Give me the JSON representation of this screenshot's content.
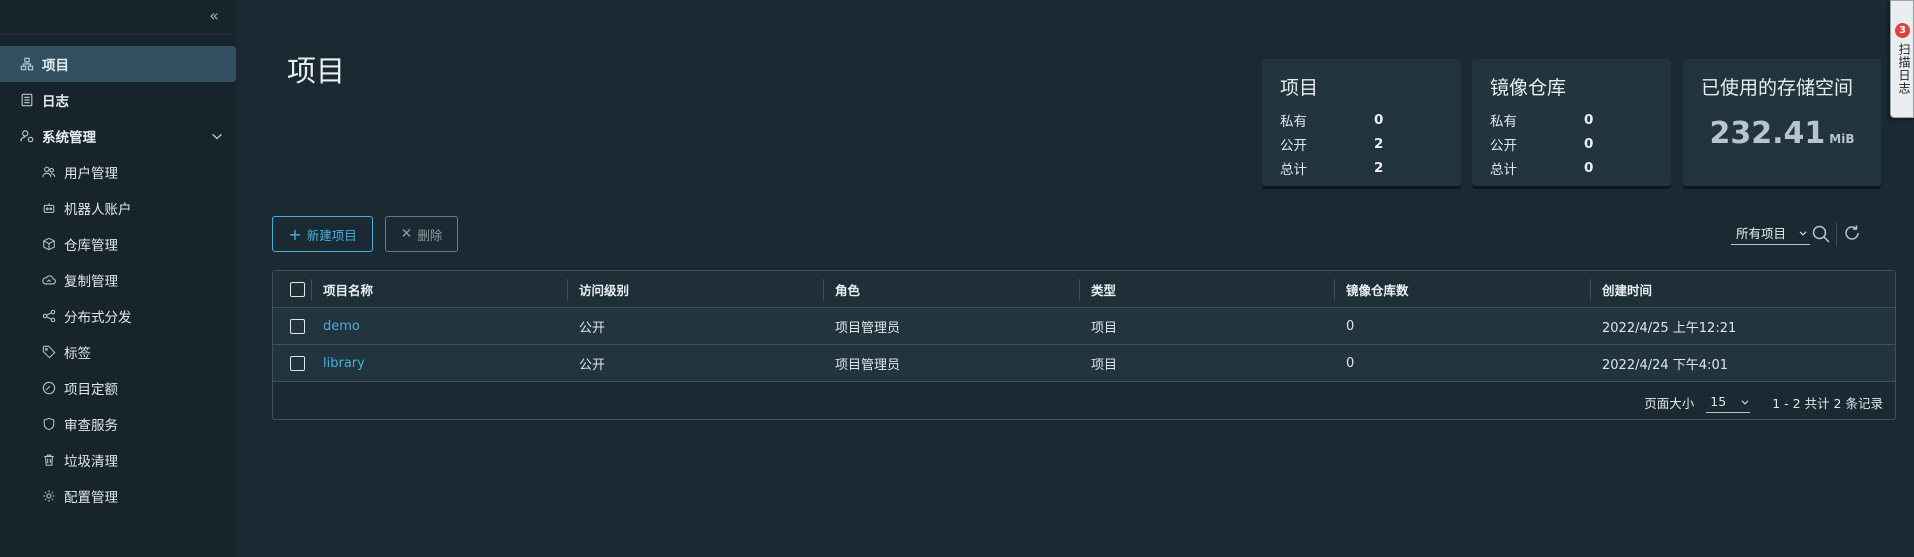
{
  "sidebar": {
    "items": [
      {
        "label": "项目",
        "icon": "projects-icon",
        "active": true
      },
      {
        "label": "日志",
        "icon": "logs-icon"
      },
      {
        "label": "系统管理",
        "icon": "admin-icon",
        "expanded": true
      },
      {
        "label": "用户管理",
        "icon": "users-icon"
      },
      {
        "label": "机器人账户",
        "icon": "robot-icon"
      },
      {
        "label": "仓库管理",
        "icon": "registry-icon"
      },
      {
        "label": "复制管理",
        "icon": "replication-icon"
      },
      {
        "label": "分布式分发",
        "icon": "distribution-icon"
      },
      {
        "label": "标签",
        "icon": "tag-icon"
      },
      {
        "label": "项目定额",
        "icon": "quota-icon"
      },
      {
        "label": "审查服务",
        "icon": "shield-icon"
      },
      {
        "label": "垃圾清理",
        "icon": "trash-icon"
      },
      {
        "label": "配置管理",
        "icon": "gear-icon"
      }
    ]
  },
  "main": {
    "title": "项目",
    "cards": {
      "projects": {
        "title": "项目",
        "rows": [
          {
            "label": "私有",
            "value": "0"
          },
          {
            "label": "公开",
            "value": "2"
          },
          {
            "label": "总计",
            "value": "2"
          }
        ]
      },
      "repos": {
        "title": "镜像仓库",
        "rows": [
          {
            "label": "私有",
            "value": "0"
          },
          {
            "label": "公开",
            "value": "0"
          },
          {
            "label": "总计",
            "value": "0"
          }
        ]
      },
      "storage": {
        "title": "已使用的存储空间",
        "value": "232.41",
        "unit": "MiB"
      }
    },
    "toolbar": {
      "new_label": "新建项目",
      "delete_label": "删除",
      "filter_value": "所有项目"
    },
    "table": {
      "headers": [
        "项目名称",
        "访问级别",
        "角色",
        "类型",
        "镜像仓库数",
        "创建时间"
      ],
      "rows": [
        [
          "demo",
          "公开",
          "项目管理员",
          "项目",
          "0",
          "2022/4/25 上午12:21"
        ],
        [
          "library",
          "公开",
          "项目管理员",
          "项目",
          "0",
          "2022/4/24 下午4:01"
        ]
      ],
      "footer": {
        "page_size_label": "页面大小",
        "page_size": "15",
        "summary": "1 - 2 共计 2 条记录"
      }
    }
  },
  "side_tab": {
    "badge": "3",
    "text": "扫描日志"
  },
  "colors": {
    "accent": "#49afd9",
    "sidebar_bg": "#17242b",
    "page_bg": "#1b2a32",
    "card_bg": "#22343d",
    "active_bg": "#324f61",
    "badge": "#e0413b"
  }
}
